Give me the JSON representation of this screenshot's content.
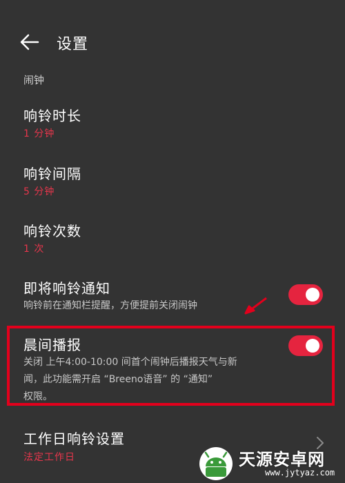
{
  "header": {
    "back_icon": "arrow-left-icon",
    "title": "设置"
  },
  "section": {
    "label": "闹钟"
  },
  "items": [
    {
      "title": "响铃时长",
      "value": "1 分钟"
    },
    {
      "title": "响铃间隔",
      "value": "5 分钟"
    },
    {
      "title": "响铃次数",
      "value": "1 次"
    },
    {
      "title": "即将响铃通知",
      "desc": "响铃前在通知栏提醒，方便提前关闭闹钟",
      "toggle_on": true
    },
    {
      "title": "晨间播报",
      "desc_lines": [
        "关闭 上午4:00-10:00 间首个闹钟后播报天气与新",
        "闻，此功能需开启 “Breeno语音” 的 “通知”",
        "权限。"
      ],
      "toggle_on": true
    },
    {
      "title": "工作日响铃设置",
      "value": "法定工作日",
      "chevron_icon": "chevron-right-icon"
    }
  ],
  "colors": {
    "background": "#333333",
    "accent": "#e5243f",
    "highlight_border": "#e3001c",
    "value_text": "#e8364c"
  },
  "watermark": {
    "name": "天源安卓网",
    "url": "www.jytyaz.com"
  }
}
